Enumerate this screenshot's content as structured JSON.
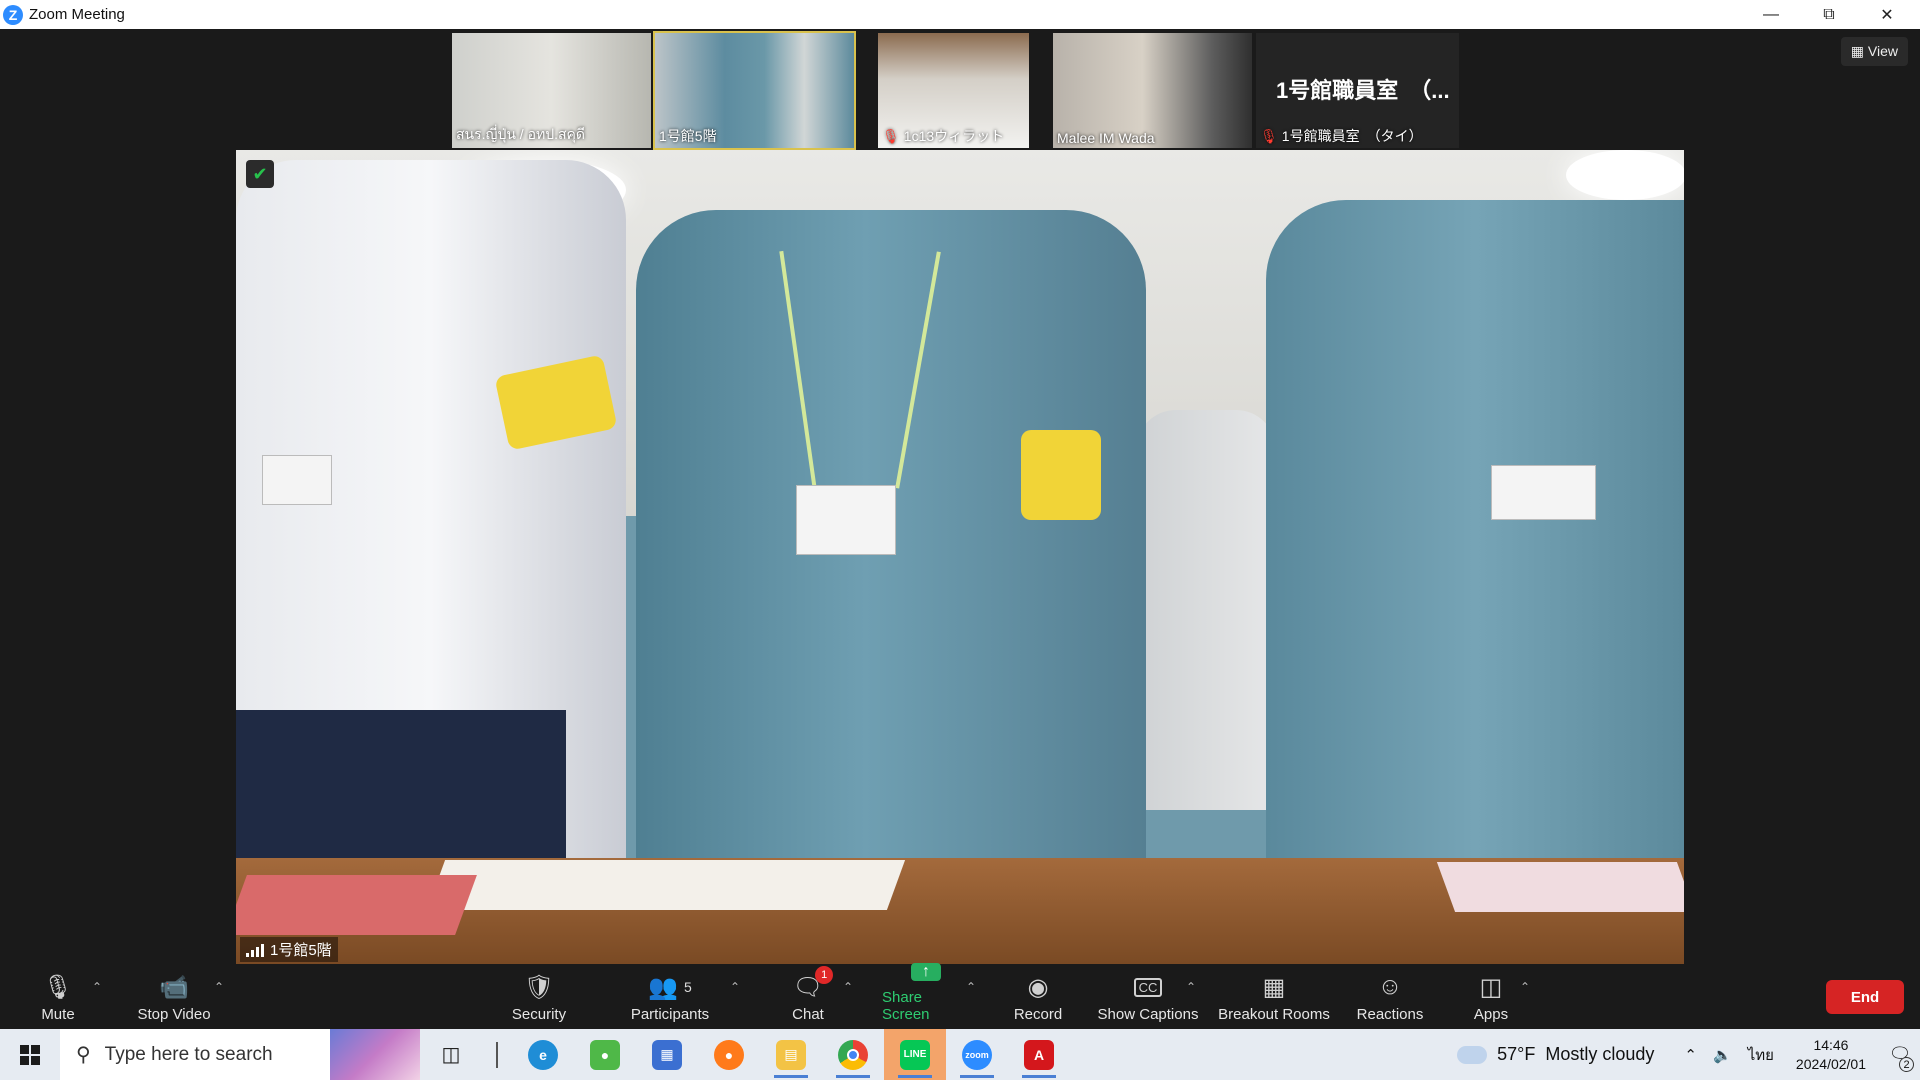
{
  "window": {
    "title": "Zoom Meeting"
  },
  "thumbnails": [
    {
      "name": "สนร.ญี่ปุ่น / อทป.สคุดี",
      "muted": false,
      "active": false
    },
    {
      "name": "1号館5階",
      "muted": false,
      "active": true
    },
    {
      "name": "1c13ウィラット",
      "muted": true,
      "active": false
    },
    {
      "name": "Malee IM Wada",
      "muted": false,
      "active": false
    },
    {
      "name": "1号館職員室　（タイ）",
      "muted": true,
      "big_title": "1号館職員室　（..."
    }
  ],
  "view_button": "View",
  "main_video": {
    "name": "1号館5階"
  },
  "toolbar": {
    "mute": "Mute",
    "stop_video": "Stop Video",
    "security": "Security",
    "participants": "Participants",
    "participants_count": "5",
    "chat": "Chat",
    "chat_badge": "1",
    "share_screen": "Share Screen",
    "record": "Record",
    "show_captions": "Show Captions",
    "breakout_rooms": "Breakout Rooms",
    "reactions": "Reactions",
    "apps": "Apps",
    "end": "End"
  },
  "taskbar": {
    "search_placeholder": "Type here to search",
    "weather_temp": "57°F",
    "weather_text": "Mostly cloudy",
    "language": "ไทย",
    "time": "14:46",
    "date": "2024/02/01",
    "notification_count": "2"
  },
  "colors": {
    "zoom_blue": "#2D8CFF",
    "end_red": "#d62424",
    "share_green": "#27ae60"
  }
}
